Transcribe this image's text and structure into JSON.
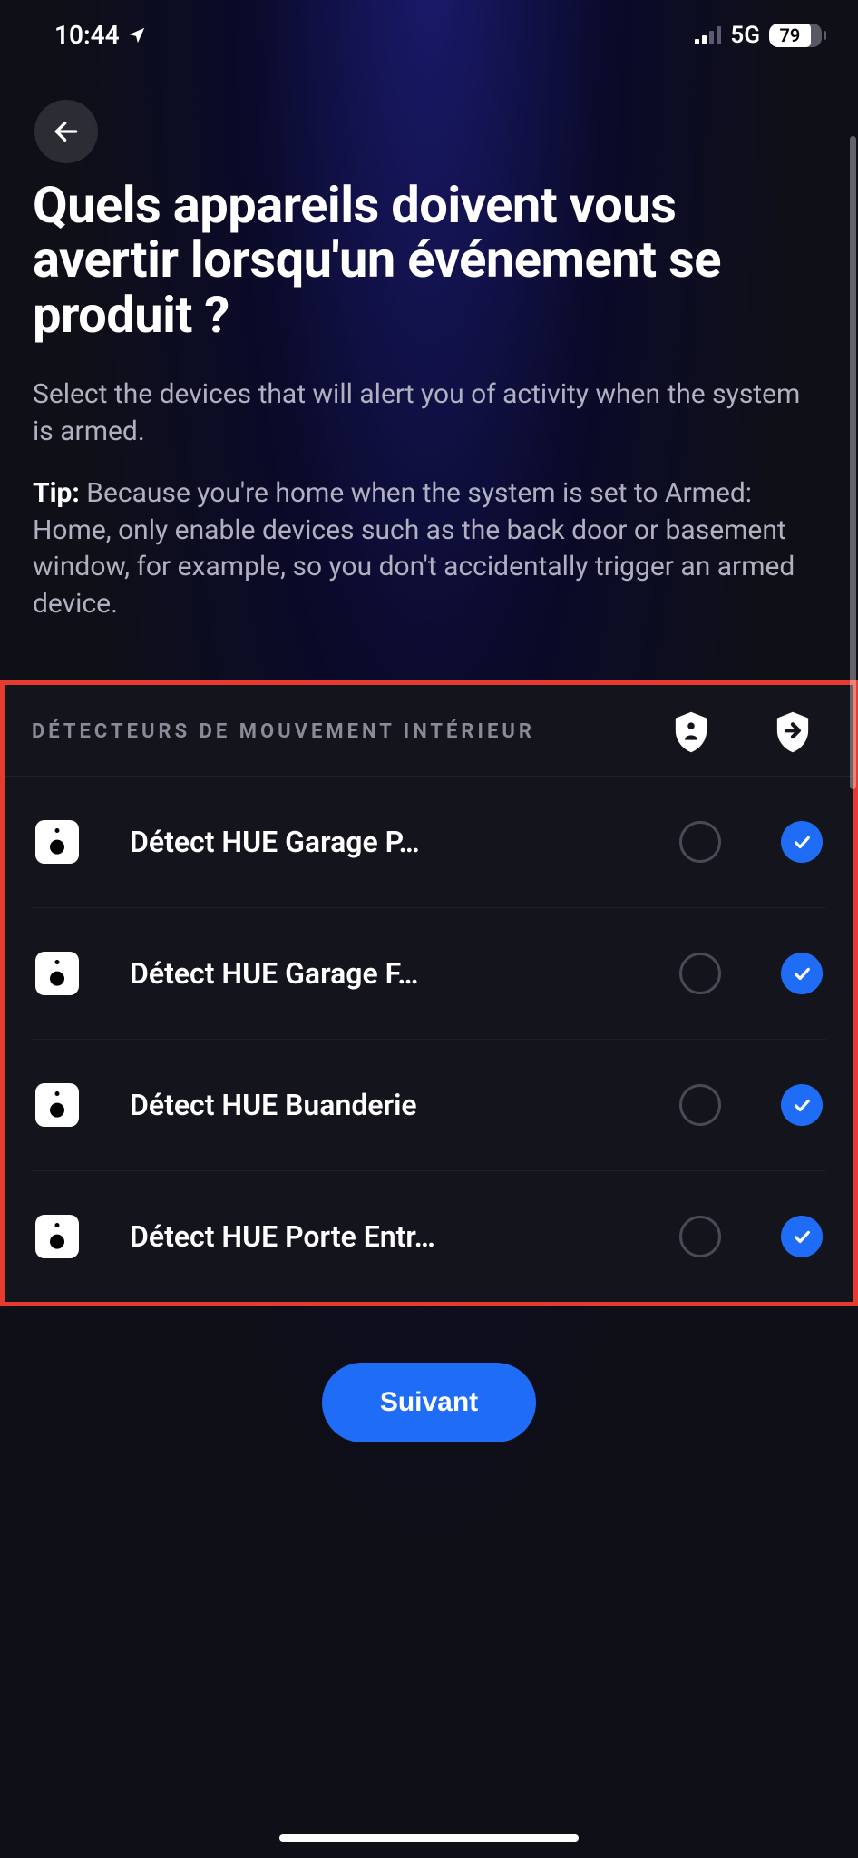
{
  "status_bar": {
    "time": "10:44",
    "network": "5G",
    "battery": "79"
  },
  "page": {
    "title": "Quels appareils doivent vous avertir lorsqu'un événement se produit ?",
    "subtitle": "Select the devices that will alert you of activity when the system is armed.",
    "tip_label": "Tip:",
    "tip_text": " Because you're home when the system is set to Armed: Home, only enable devices such as the back door or basement window, for example, so you don't accidentally trigger an armed device."
  },
  "section": {
    "label": "DÉTECTEURS DE MOUVEMENT INTÉRIEUR",
    "devices": [
      {
        "name": "Détect HUE Garage P…",
        "home_checked": false,
        "away_checked": true
      },
      {
        "name": "Détect HUE Garage F…",
        "home_checked": false,
        "away_checked": true
      },
      {
        "name": "Détect HUE Buanderie",
        "home_checked": false,
        "away_checked": true
      },
      {
        "name": "Détect HUE Porte Entr…",
        "home_checked": false,
        "away_checked": true
      }
    ]
  },
  "footer": {
    "next": "Suivant"
  }
}
